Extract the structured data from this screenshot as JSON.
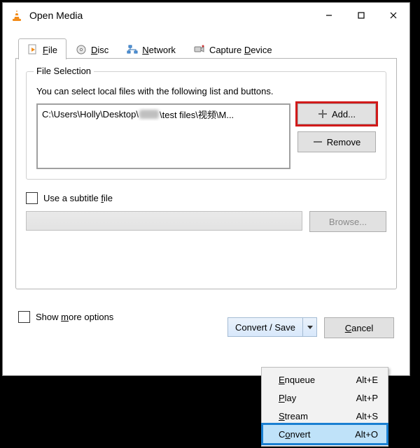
{
  "window": {
    "title": "Open Media"
  },
  "tabs": {
    "file_pref": "",
    "file_ul": "F",
    "file_suf": "ile",
    "disc_pref": "",
    "disc_ul": "D",
    "disc_suf": "isc",
    "net_pref": "",
    "net_ul": "N",
    "net_suf": "etwork",
    "cap_pref": "Capture ",
    "cap_ul": "D",
    "cap_suf": "evice"
  },
  "fileSelection": {
    "legend": "File Selection",
    "hint": "You can select local files with the following list and buttons.",
    "path_prefix": "C:\\Users\\Holly\\Desktop\\",
    "path_suffix": "\\test files\\视频\\M...",
    "add": "Add...",
    "remove": "Remove"
  },
  "subtitle": {
    "label_pref": "Use a subtitle ",
    "label_ul": "f",
    "label_suf": "ile",
    "browse": "Browse..."
  },
  "footer": {
    "more_pref": "Show ",
    "more_ul": "m",
    "more_suf": "ore options",
    "convert_save": "Convert / Save",
    "cancel_ul": "C",
    "cancel_suf": "ancel"
  },
  "menu": {
    "items": [
      {
        "pref": "",
        "ul": "E",
        "suf": "nqueue",
        "shortcut": "Alt+E"
      },
      {
        "pref": "",
        "ul": "P",
        "suf": "lay",
        "shortcut": "Alt+P"
      },
      {
        "pref": "",
        "ul": "S",
        "suf": "tream",
        "shortcut": "Alt+S"
      },
      {
        "pref": "C",
        "ul": "o",
        "suf": "nvert",
        "shortcut": "Alt+O"
      }
    ]
  }
}
